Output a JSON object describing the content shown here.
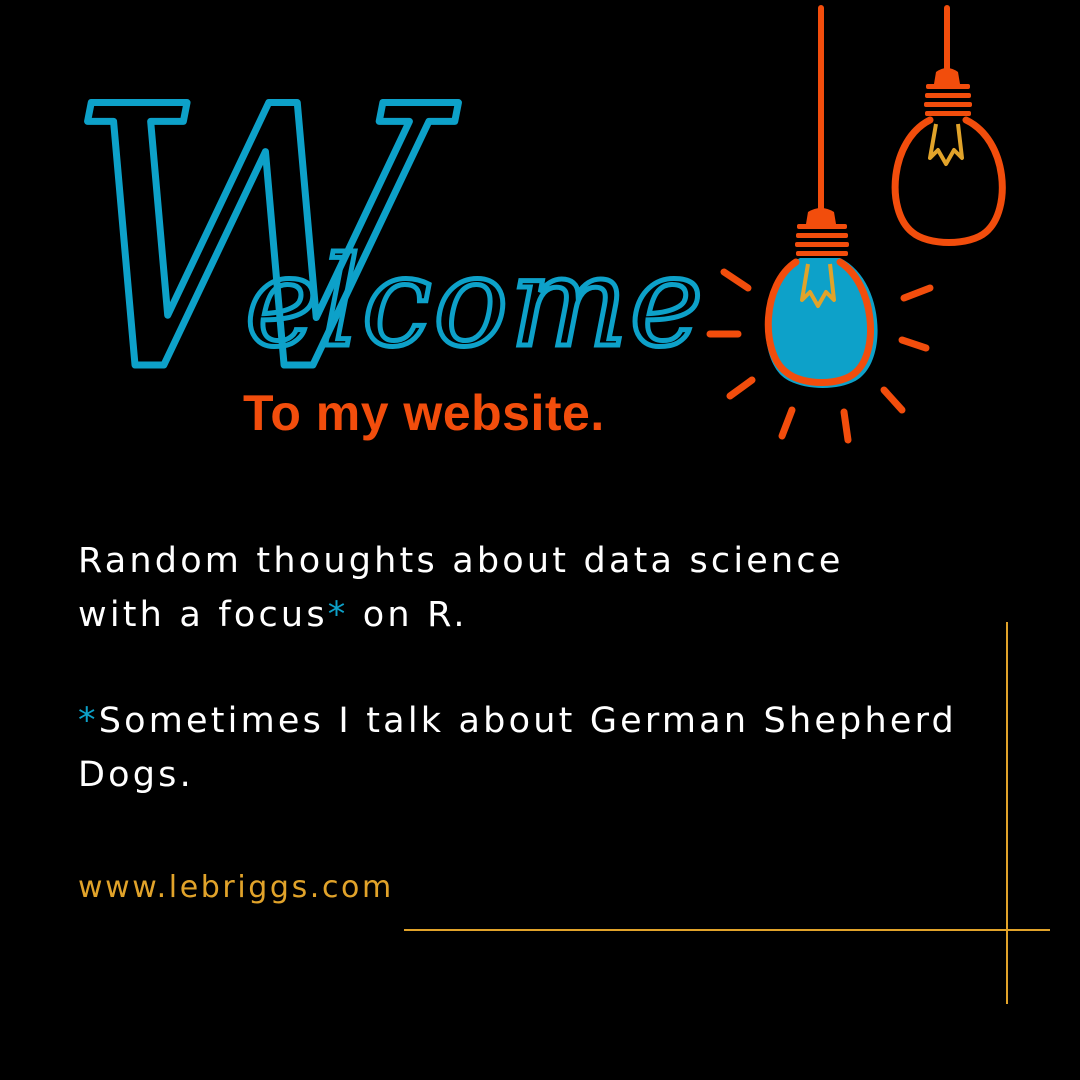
{
  "colors": {
    "background": "#000000",
    "script_blue": "#0da1c9",
    "orange": "#f24d0c",
    "gold": "#e1a32a",
    "text": "#ffffff"
  },
  "hero": {
    "welcome_initial": "W",
    "welcome_rest": "elcome",
    "subtitle": "To my website."
  },
  "body": {
    "line1": "Random thoughts about data science",
    "line2_before": "with a focus",
    "line2_asterisk": "*",
    "line2_after": " on R.",
    "note_asterisk": "*",
    "note_text": "Sometimes I talk about German Shepherd Dogs."
  },
  "footer": {
    "url": "www.lebriggs.com"
  },
  "decor": {
    "icons": [
      "light-bulb-glowing-icon",
      "light-bulb-icon"
    ]
  }
}
